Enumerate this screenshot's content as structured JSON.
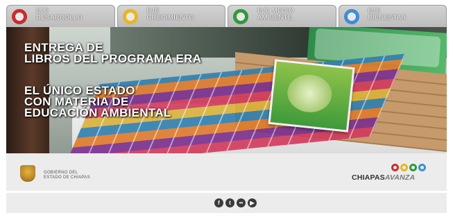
{
  "tabs": [
    {
      "label_1": "EJE",
      "label_2": "DESARROLLO",
      "ring_color": "#cc2b2b"
    },
    {
      "label_1": "EJE",
      "label_2": "CRECIMIENTO",
      "ring_color": "#e8b620"
    },
    {
      "label_1": "EJE MEDIO",
      "label_2": "AMBIENTE",
      "ring_color": "#2f9a3a"
    },
    {
      "label_1": "EJE",
      "label_2": "BIENESTAR",
      "ring_color": "#3d8fd6"
    }
  ],
  "banner": {
    "line_1": "ENTREGA DE",
    "line_2": "LIBROS DEL PROGRAMA ERA",
    "line_3": "EL ÚNICO ESTADO",
    "line_4": "CON MATERIA DE",
    "line_5": "EDUCACIÓN AMBIENTAL"
  },
  "footer": {
    "gov_line_1": "GOBIERNO DEL",
    "gov_line_2": "ESTADO DE CHIAPAS",
    "brand_part_1": "CHIAPAS",
    "brand_part_2": "AVANZA",
    "brand_dot_colors": [
      "#cc2b2b",
      "#e8b620",
      "#2f9a3a",
      "#3d8fd6"
    ]
  },
  "social": [
    {
      "icon": "facebook-icon",
      "glyph": "f"
    },
    {
      "icon": "twitter-icon",
      "glyph": "t"
    },
    {
      "icon": "flickr-icon",
      "glyph": "••"
    },
    {
      "icon": "youtube-icon",
      "glyph": "▶"
    }
  ]
}
